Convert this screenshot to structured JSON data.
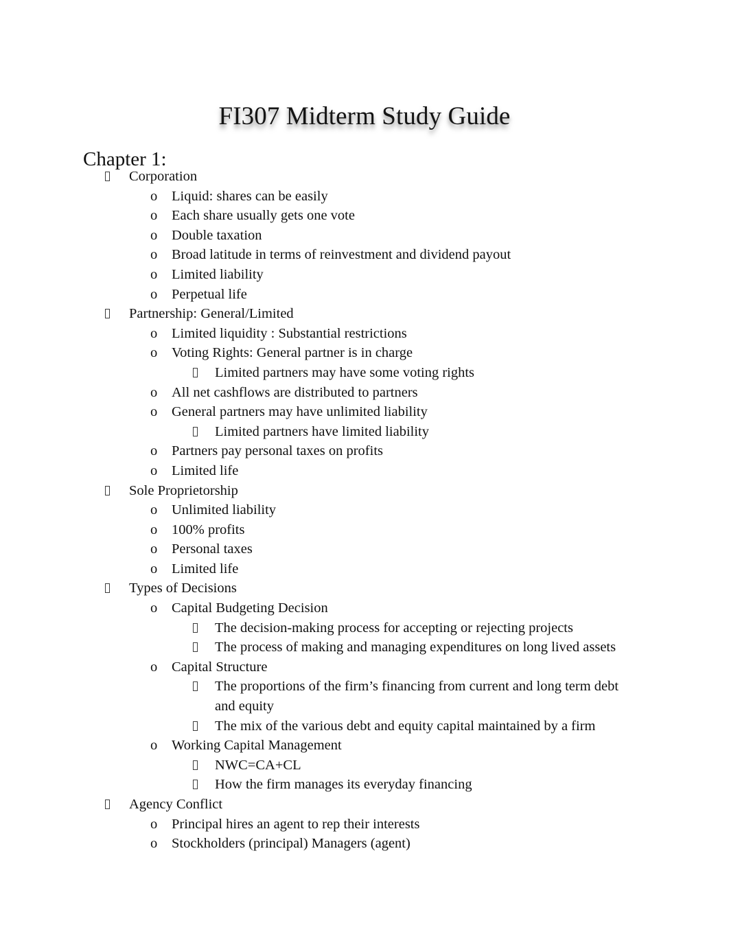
{
  "document": {
    "title": "FI307 Midterm Study Guide",
    "heading": "Chapter 1:",
    "bullet_glyphs": {
      "level1": "▯",
      "level2": "o",
      "level3": "▯"
    },
    "colors": {
      "page_background": "#ffffff",
      "text": "#101010",
      "title_shadow": "#787878"
    },
    "outline": [
      {
        "level": 1,
        "text": "Corporation"
      },
      {
        "level": 2,
        "text": "Liquid: shares can be easily"
      },
      {
        "level": 2,
        "text": "Each share usually gets one vote"
      },
      {
        "level": 2,
        "text": "Double taxation"
      },
      {
        "level": 2,
        "text": "Broad latitude in terms of reinvestment and dividend payout"
      },
      {
        "level": 2,
        "text": "Limited liability"
      },
      {
        "level": 2,
        "text": "Perpetual life"
      },
      {
        "level": 1,
        "text": "Partnership: General/Limited"
      },
      {
        "level": 2,
        "text": "Limited liquidity : Substantial restrictions"
      },
      {
        "level": 2,
        "text": "Voting Rights: General partner is in charge"
      },
      {
        "level": 3,
        "text": "Limited partners may have some voting rights"
      },
      {
        "level": 2,
        "text": "All net cashflows are distributed to partners"
      },
      {
        "level": 2,
        "text": "General partners may have unlimited liability"
      },
      {
        "level": 3,
        "text": "Limited partners have limited liability"
      },
      {
        "level": 2,
        "text": "Partners pay personal taxes on profits"
      },
      {
        "level": 2,
        "text": "Limited life"
      },
      {
        "level": 1,
        "text": "Sole Proprietorship"
      },
      {
        "level": 2,
        "text": "Unlimited liability"
      },
      {
        "level": 2,
        "text": "100% profits"
      },
      {
        "level": 2,
        "text": "Personal taxes"
      },
      {
        "level": 2,
        "text": "Limited life"
      },
      {
        "level": 1,
        "text": "Types of Decisions"
      },
      {
        "level": 2,
        "text": "Capital Budgeting Decision"
      },
      {
        "level": 3,
        "text": "The decision-making process for accepting or rejecting projects"
      },
      {
        "level": 3,
        "text": "The process of making and managing expenditures on long lived assets"
      },
      {
        "level": 2,
        "text": "Capital Structure"
      },
      {
        "level": 3,
        "text": "The proportions of the firm’s financing from current and long term debt and equity"
      },
      {
        "level": 3,
        "text": "The mix of the various debt and equity capital maintained by a firm"
      },
      {
        "level": 2,
        "text": "Working Capital Management"
      },
      {
        "level": 3,
        "text": "NWC=CA+CL"
      },
      {
        "level": 3,
        "text": "How the firm manages its everyday financing"
      },
      {
        "level": 1,
        "text": "Agency Conflict"
      },
      {
        "level": 2,
        "text": "Principal hires an agent to rep their interests"
      },
      {
        "level": 2,
        "text": "Stockholders (principal) Managers (agent)"
      }
    ]
  }
}
